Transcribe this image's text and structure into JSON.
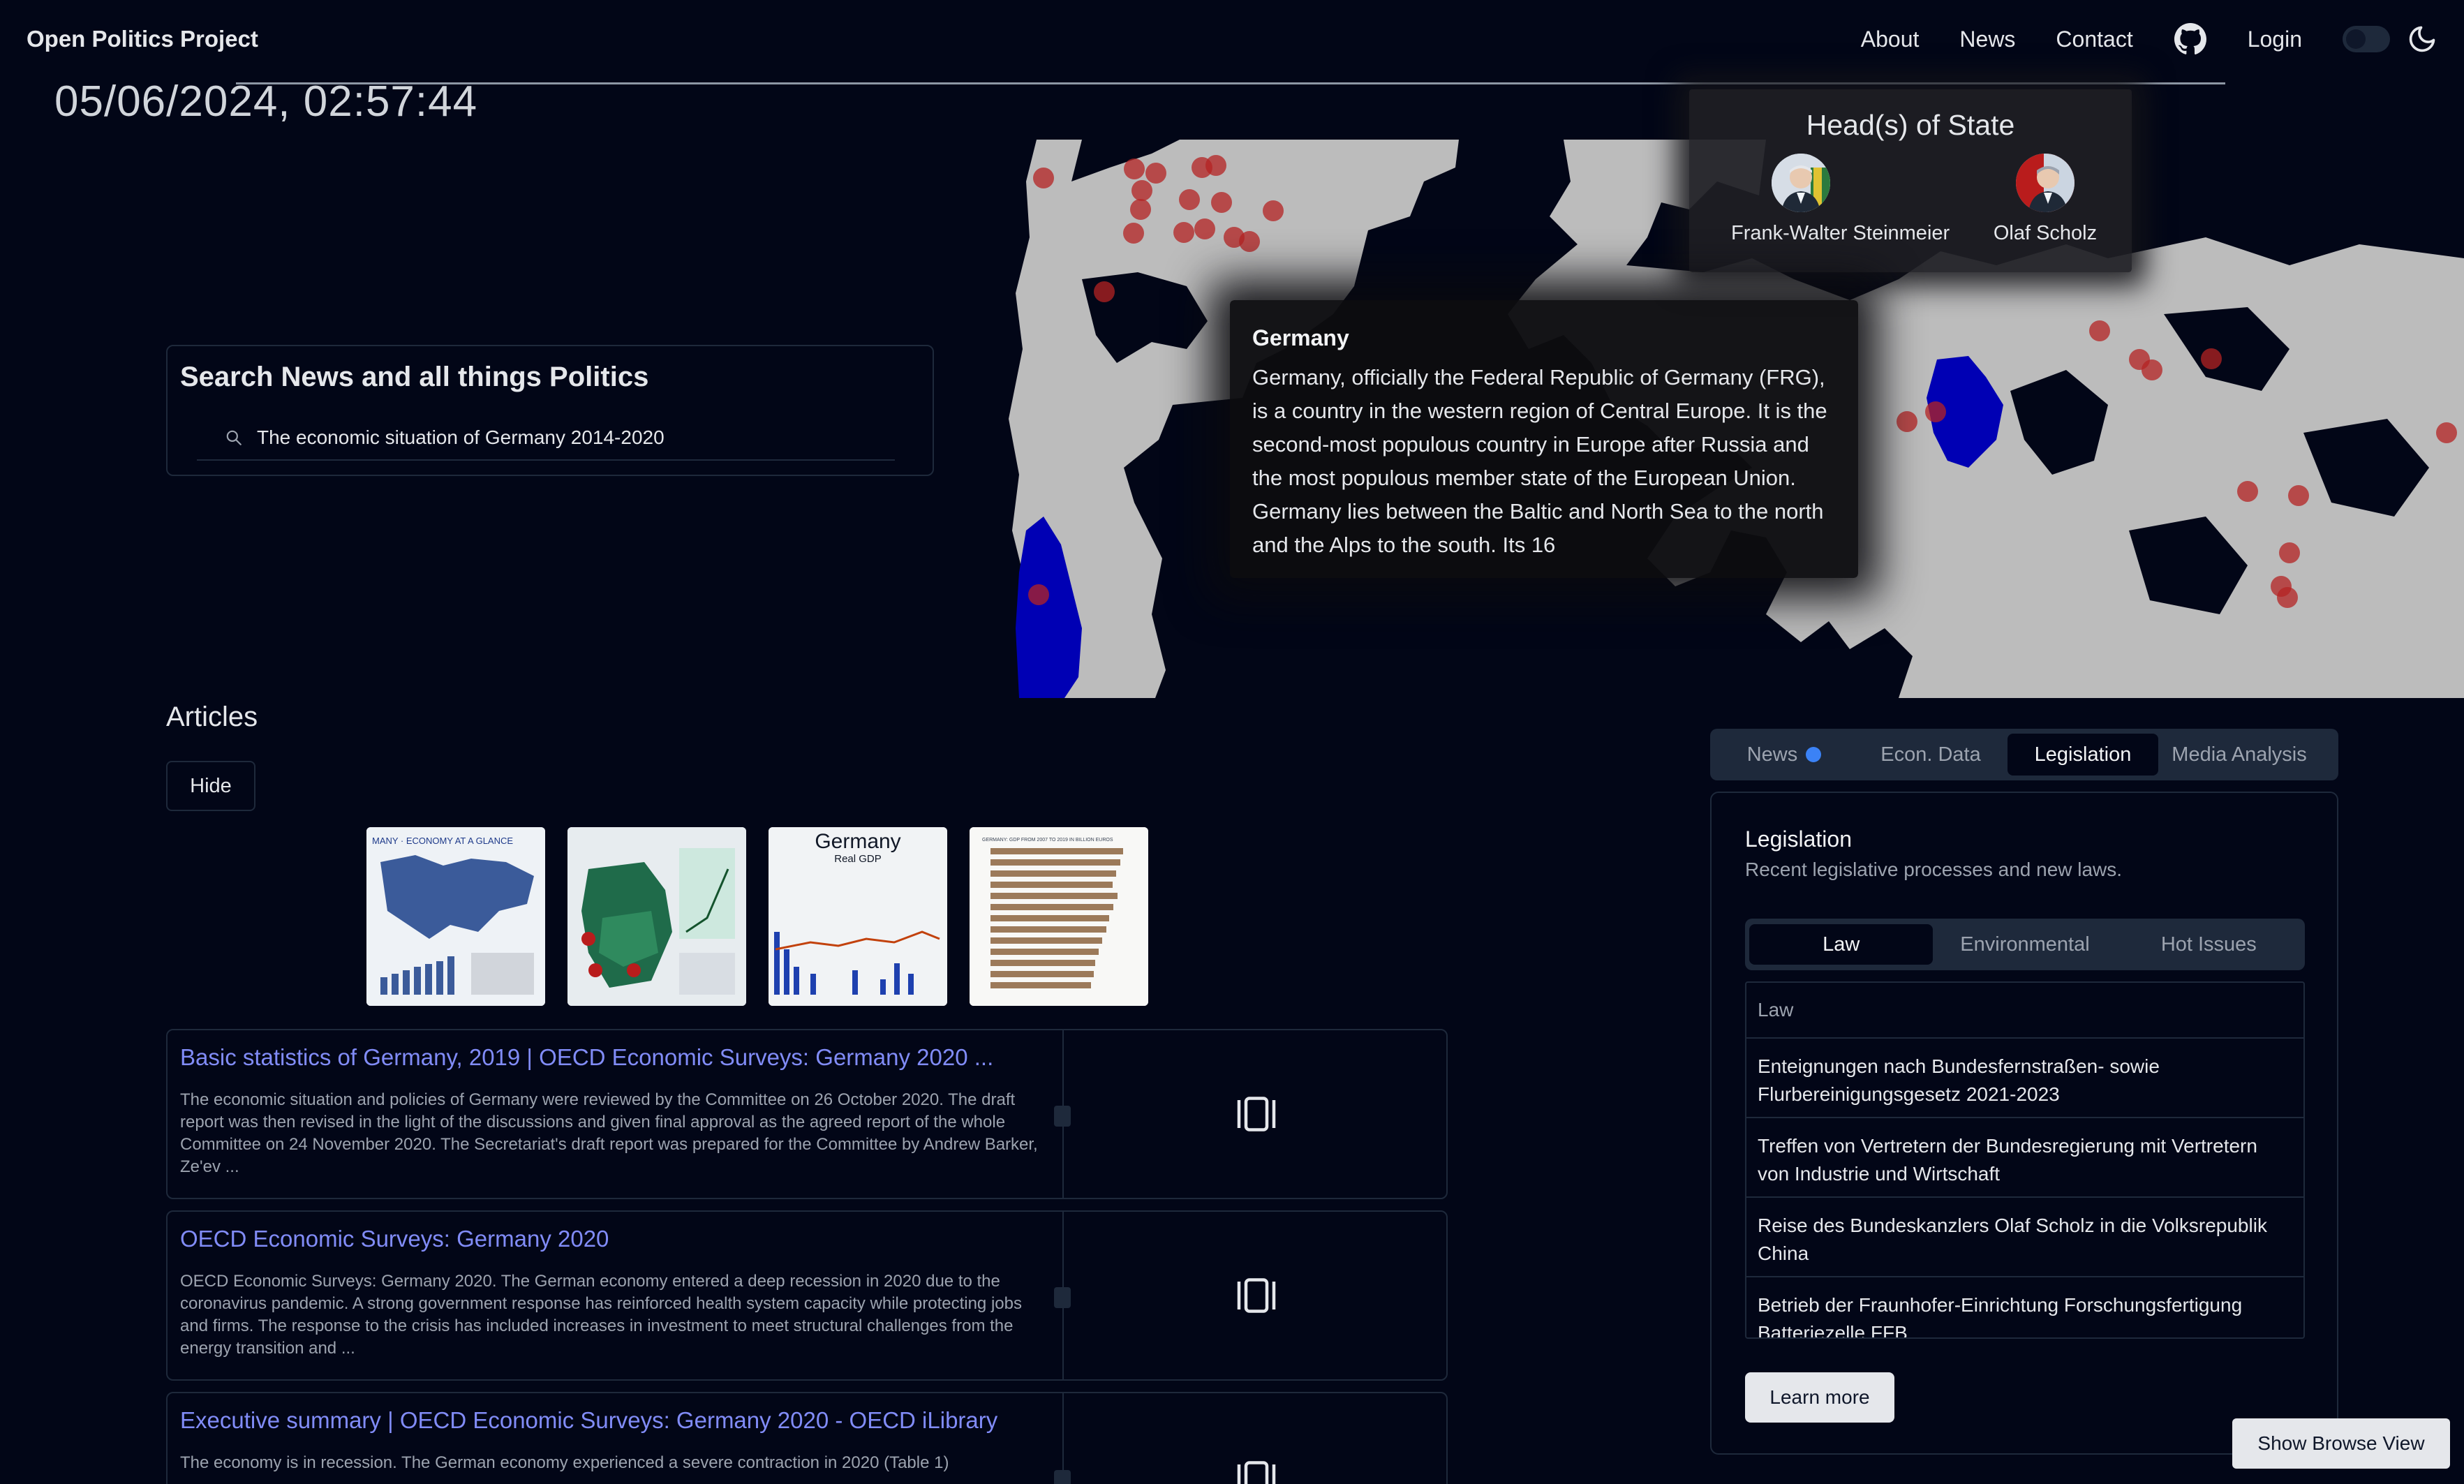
{
  "navbar": {
    "brand": "Open Politics Project",
    "links": [
      "About",
      "News",
      "Contact"
    ],
    "login": "Login"
  },
  "clock": "05/06/2024, 02:57:44",
  "heads_of_state": {
    "title": "Head(s) of State",
    "people": [
      "Frank-Walter Steinmeier",
      "Olaf Scholz"
    ]
  },
  "country_info": {
    "name": "Germany",
    "text": "Germany, officially the Federal Republic of Germany (FRG), is a country in the western region of Central Europe. It is the second-most populous country in Europe after Russia and the most populous member state of the European Union. Germany lies between the Baltic and North Sea to the north and the Alps to the south. Its 16"
  },
  "search": {
    "title": "Search News and all things Politics",
    "value": "The economic situation of Germany 2014-2020"
  },
  "articles": {
    "title": "Articles",
    "hide_label": "Hide",
    "thumbnails": [
      {
        "caption": "MANY · ECONOMY AT A GLANCE"
      },
      {
        "caption": ""
      },
      {
        "caption": "Germany",
        "subcaption": "Real GDP"
      },
      {
        "caption": "GERMANY: GDP FROM 2007 TO 2019 IN BILLION EUROS"
      }
    ],
    "items": [
      {
        "title": "Basic statistics of Germany, 2019 | OECD Economic Surveys: Germany 2020 ...",
        "text": "The economic situation and policies of Germany were reviewed by the Committee on 26 October 2020. The draft report was then revised in the light of the discussions and given final approval as the agreed report of the whole Committee on 24 November 2020. The Secretariat's draft report was prepared for the Committee by Andrew Barker, Ze'ev ..."
      },
      {
        "title": "OECD Economic Surveys: Germany 2020",
        "text": "OECD Economic Surveys: Germany 2020. The German economy entered a deep recession in 2020 due to the coronavirus pandemic. A strong government response has reinforced health system capacity while protecting jobs and firms. The response to the crisis has included increases in investment to meet structural challenges from the energy transition and ..."
      },
      {
        "title": "Executive summary | OECD Economic Surveys: Germany 2020 - OECD iLibrary",
        "text": "The economy is in recession. The German economy experienced a severe contraction in 2020 (Table 1)"
      }
    ]
  },
  "tabs": {
    "items": [
      "News",
      "Econ. Data",
      "Legislation",
      "Media Analysis"
    ],
    "active": "Legislation"
  },
  "legislation": {
    "title": "Legislation",
    "subtitle": "Recent legislative processes and new laws.",
    "subtabs": [
      "Law",
      "Environmental",
      "Hot Issues"
    ],
    "active_subtab": "Law",
    "table_header": "Law",
    "rows": [
      "Enteignungen nach Bundesfernstraßen- sowie Flurbereinigungsgesetz 2021-2023",
      "Treffen von Vertretern der Bundesregierung mit Vertretern von Industrie und Wirtschaft",
      "Reise des Bundeskanzlers Olaf Scholz in die Volksrepublik China",
      "Betrieb der Fraunhofer-Einrichtung Forschungsfertigung Batteriezelle FFB"
    ],
    "learn_more": "Learn more"
  },
  "browse_button": "Show Browse View",
  "colors": {
    "background": "#020617",
    "land": "#bcbcbc",
    "highlight_country": "#0000b4",
    "event_marker": "#b42323",
    "link": "#818cf8",
    "news_dot": "#3b82f6"
  }
}
